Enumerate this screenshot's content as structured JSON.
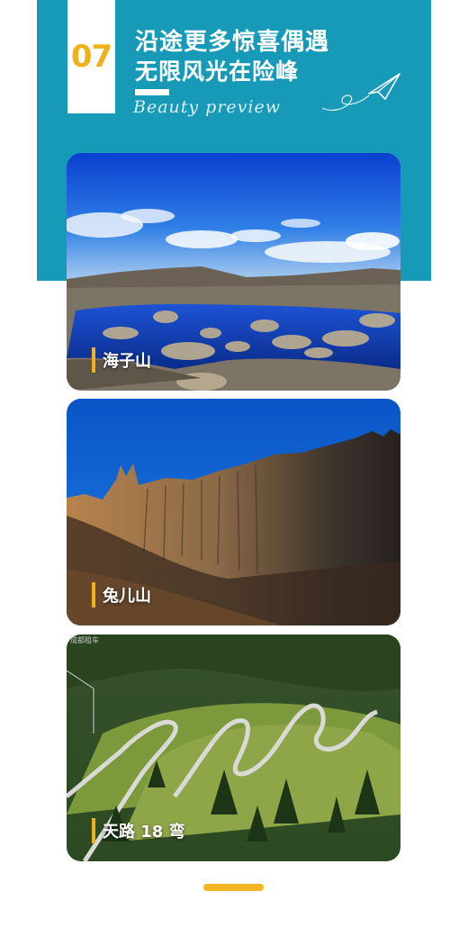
{
  "header": {
    "number": "07",
    "title_line1": "沿途更多惊喜偶遇",
    "title_line2": "无限风光在险峰",
    "subtitle_script": "Beauty preview"
  },
  "colors": {
    "band": "#169ab8",
    "accent": "#f0b21c"
  },
  "cards": [
    {
      "label": "海子山",
      "scene": "alpine-lake"
    },
    {
      "label": "兔儿山",
      "scene": "rocky-ridge"
    },
    {
      "label": "天路 18 弯",
      "scene": "winding-road",
      "watermark": "成都租车"
    }
  ],
  "icons": {
    "plane": "paper-plane-icon"
  }
}
